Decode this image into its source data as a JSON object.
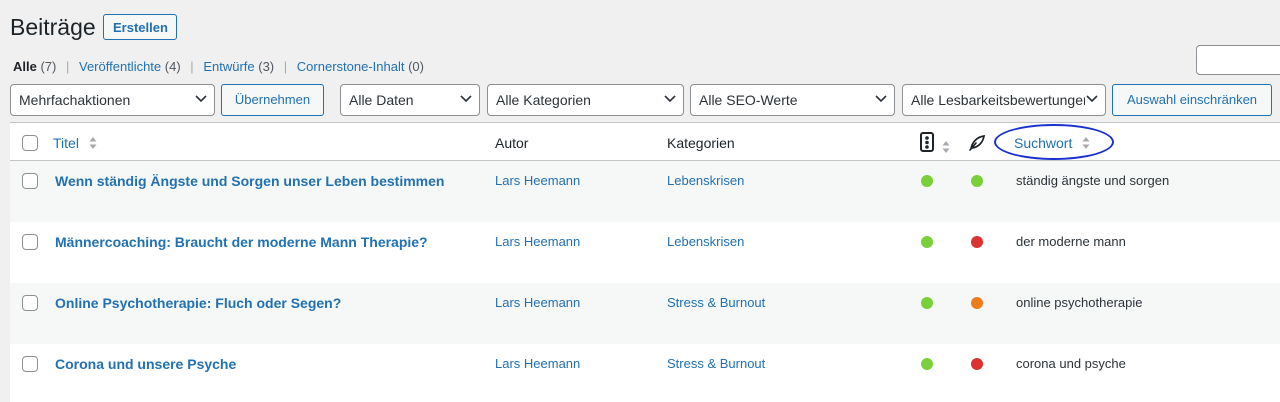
{
  "page": {
    "title": "Beiträge",
    "add_new": "Erstellen"
  },
  "views": [
    {
      "label": "Alle",
      "count": "(7)"
    },
    {
      "label": "Veröffentlichte",
      "count": "(4)"
    },
    {
      "label": "Entwürfe",
      "count": "(3)"
    },
    {
      "label": "Cornerstone-Inhalt",
      "count": "(0)"
    }
  ],
  "filters": {
    "bulk_action": "Mehrfachaktionen",
    "apply": "Übernehmen",
    "dates": "Alle Daten",
    "categories": "Alle Kategorien",
    "seo": "Alle SEO-Werte",
    "readability": "Alle Lesbarkeitsbewertungen",
    "filter_button": "Auswahl einschränken"
  },
  "columns": {
    "title": "Titel",
    "author": "Autor",
    "categories": "Kategorien",
    "keyword": "Suchwort"
  },
  "colors": {
    "good": "#7ad03a",
    "bad": "#dc3232",
    "ok": "#ee7c1b",
    "link": "#2271b1"
  },
  "rows": [
    {
      "title": "Wenn ständig Ängste und Sorgen unser Leben bestimmen",
      "author": "Lars Heemann",
      "category": "Lebenskrisen",
      "seo": "good",
      "readability": "good",
      "keyword": "ständig ängste und sorgen"
    },
    {
      "title": "Männercoaching: Braucht der moderne Mann Therapie?",
      "author": "Lars Heemann",
      "category": "Lebenskrisen",
      "seo": "good",
      "readability": "bad",
      "keyword": "der moderne mann"
    },
    {
      "title": "Online Psychotherapie: Fluch oder Segen?",
      "author": "Lars Heemann",
      "category": "Stress & Burnout",
      "seo": "good",
      "readability": "ok",
      "keyword": "online psychotherapie"
    },
    {
      "title": "Corona und unsere Psyche",
      "author": "Lars Heemann",
      "category": "Stress & Burnout",
      "seo": "good",
      "readability": "bad",
      "keyword": "corona und psyche"
    }
  ]
}
